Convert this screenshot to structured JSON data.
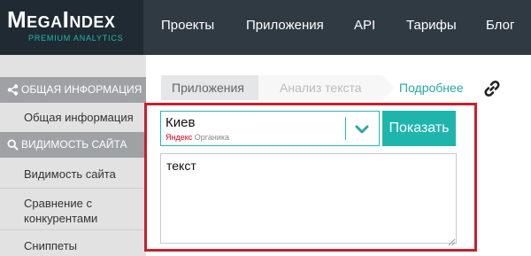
{
  "logo": {
    "title": "MegaIndex",
    "subtitle": "PREMIUM ANALYTICS"
  },
  "nav": {
    "items": [
      "Проекты",
      "Приложения",
      "API",
      "Тарифы",
      "Блог"
    ]
  },
  "sidebar": {
    "section1": {
      "icon": "share-icon",
      "label": "ОБЩАЯ ИНФОРМАЦИЯ",
      "items": [
        "Общая информация"
      ]
    },
    "section2": {
      "icon": "search-icon",
      "label": "ВИДИМОСТЬ САЙТА",
      "items": [
        "Видимость сайта",
        "Сравнение с конкурентами",
        "Сниппеты"
      ]
    }
  },
  "breadcrumb": {
    "items": [
      "Приложения",
      "Анализ текста"
    ]
  },
  "more_link": "Подробнее",
  "form": {
    "region_value": "Киев",
    "region_source_brand": "Яндекс",
    "region_source_label": "Органика",
    "show_button": "Показать",
    "text_value": "текст"
  },
  "colors": {
    "accent": "#1fb5ad",
    "highlight": "#c8202c",
    "topbar": "#2f3a43"
  }
}
